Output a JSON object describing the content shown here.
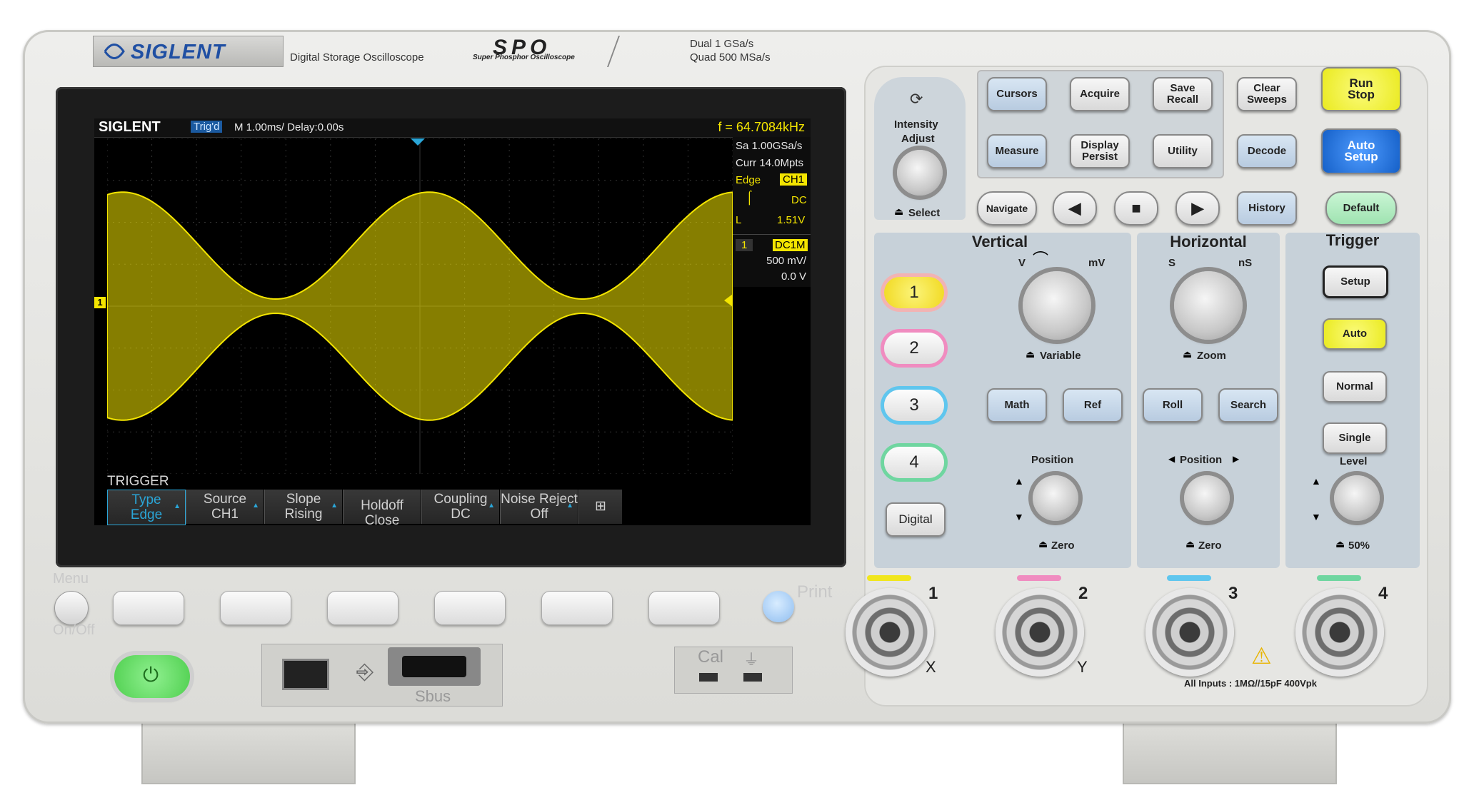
{
  "header": {
    "brand": "SIGLENT",
    "product": "Digital Storage Oscilloscope",
    "spo_logo": "SPO",
    "spo_tagline": "Super Phosphor Oscilloscope",
    "spec_line1": "Dual  1 GSa/s",
    "spec_line2": "Quad  500 MSa/s"
  },
  "screen": {
    "brand": "SIGLENT",
    "trig_status": "Trig'd",
    "timebase": "M 1.00ms/ Delay:0.00s",
    "frequency": "f = 64.7084kHz",
    "sample_rate": "Sa 1.00GSa/s",
    "memory": "Curr 14.0Mpts",
    "trigger_type": "Edge",
    "trigger_source": "CH1",
    "trigger_coupling": "DC",
    "trigger_level_label": "L",
    "trigger_level": "1.51V",
    "ch_number": "1",
    "ch_coupling": "DC1M",
    "ch_scale": "500 mV/",
    "ch_offset": "0.0 V",
    "ch_marker": "1",
    "menu_title": "TRIGGER",
    "softkeys": [
      {
        "line1": "Type",
        "line2": "Edge"
      },
      {
        "line1": "Source",
        "line2": "CH1"
      },
      {
        "line1": "Slope",
        "line2": "Rising"
      },
      {
        "line1": "Holdoff Close",
        "line2": ""
      },
      {
        "line1": "Coupling",
        "line2": "DC"
      },
      {
        "line1": "Noise Reject",
        "line2": "Off"
      }
    ],
    "waveform_color": "#f4e500"
  },
  "front": {
    "menu_label": "Menu",
    "onoff_label": "On/Off",
    "print_label": "Print",
    "sbus_label": "Sbus",
    "cal_label": "Cal"
  },
  "control": {
    "intensity_label": "Intensity",
    "adjust_label": "Adjust",
    "select_label": "Select",
    "buttons": {
      "cursors": "Cursors",
      "acquire": "Acquire",
      "save": "Save",
      "recall": "Recall",
      "clear": "Clear",
      "sweeps": "Sweeps",
      "run": "Run",
      "stop": "Stop",
      "measure": "Measure",
      "display": "Display",
      "persist": "Persist",
      "utility": "Utility",
      "decode": "Decode",
      "auto": "Auto",
      "setup": "Setup",
      "navigate": "Navigate",
      "history": "History",
      "default": "Default"
    },
    "vertical": {
      "title": "Vertical",
      "v": "V",
      "mv": "mV",
      "variable": "Variable",
      "math": "Math",
      "ref": "Ref",
      "position": "Position",
      "zero": "Zero",
      "ch1": "1",
      "ch2": "2",
      "ch3": "3",
      "ch4": "4",
      "digital": "Digital"
    },
    "horizontal": {
      "title": "Horizontal",
      "s": "S",
      "ns": "nS",
      "zoom": "Zoom",
      "roll": "Roll",
      "search": "Search",
      "position": "Position",
      "zero": "Zero"
    },
    "trigger": {
      "title": "Trigger",
      "setup": "Setup",
      "auto": "Auto",
      "normal": "Normal",
      "single": "Single",
      "level": "Level",
      "fifty": "50%"
    },
    "inputs": {
      "ch1": "1",
      "ch2": "2",
      "ch3": "3",
      "ch4": "4",
      "x": "X",
      "y": "Y",
      "rating": "All Inputs : 1MΩ//15pF 400Vpk"
    },
    "colors": {
      "ch1": "#f1e61d",
      "ch2": "#f08cc0",
      "ch3": "#5fc6ee",
      "ch4": "#6fd6a0",
      "run_stop": "#f3f22a",
      "auto_setup": "#1e6fd9",
      "default": "#a9e9b9",
      "power": "#6ee06e"
    }
  }
}
